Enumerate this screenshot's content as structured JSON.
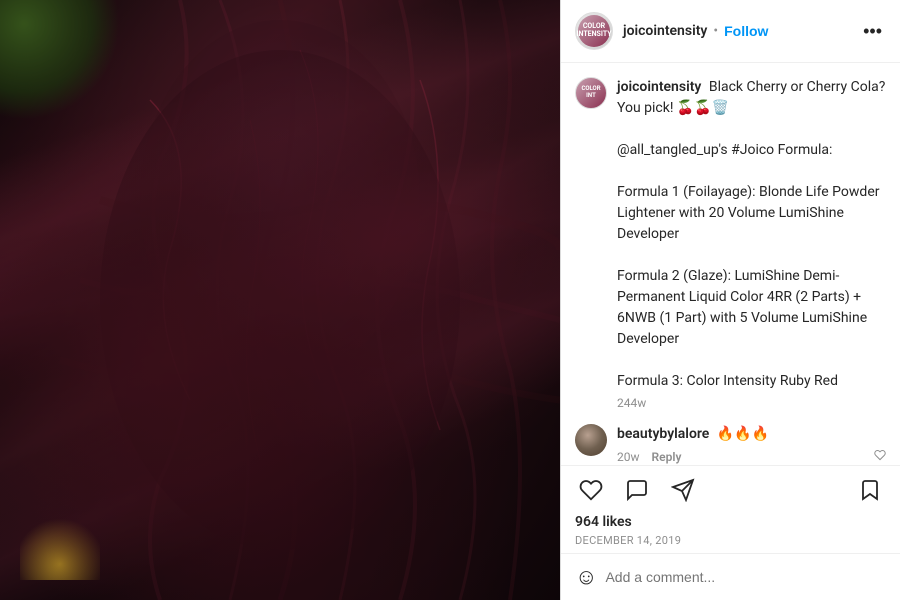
{
  "header": {
    "username": "joicointensity",
    "separator": "•",
    "follow_label": "Follow",
    "more_icon": "•••",
    "avatar_text": "COLOR\nINTENSITY"
  },
  "main_post": {
    "username": "joicointensity",
    "time_ago": "244w",
    "caption": "Black Cherry or Cherry Cola? You pick!",
    "emojis": "🍒🍒🗑️",
    "body": "@all_tangled_up's #Joico Formula:\n\nFormula 1 (Foilayage): Blonde Life Powder Lightener with 20 Volume LumiShine Developer\n\nFormula 2 (Glaze): LumiShine Demi-Permanent Liquid Color 4RR (2 Parts) + 6NWB (1 Part) with 5 Volume LumiShine Developer\n\nFormula 3: Color Intensity Ruby Red"
  },
  "comments": [
    {
      "username": "beautybylalore",
      "time_ago": "20w",
      "text": "🔥🔥🔥",
      "reply_label": "Reply"
    }
  ],
  "actions": {
    "likes": "964 likes",
    "date": "December 14, 2019"
  },
  "add_comment": {
    "placeholder": "Add a comment..."
  }
}
